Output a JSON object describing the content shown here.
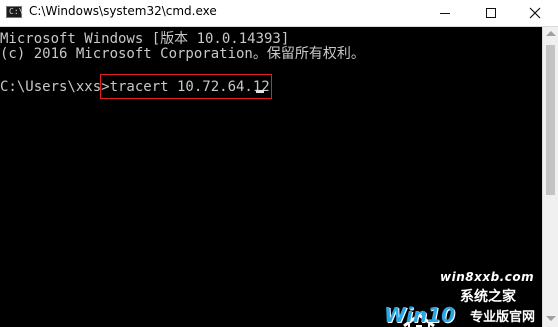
{
  "window": {
    "title": "C:\\Windows\\system32\\cmd.exe",
    "icon": "cmd-icon",
    "icon_text": "C:\\"
  },
  "console": {
    "lines": [
      "Microsoft Windows [版本 10.0.14393]",
      "(c) 2016 Microsoft Corporation。保留所有权利。",
      "C:\\Users\\xxs>tracert 10.72.64.12"
    ],
    "prompt": "C:\\Users\\xxs>",
    "command": "tracert 10.72.64.12",
    "highlight_color": "#e02020"
  },
  "watermark": {
    "top": "win8xxb.com",
    "mid": "系统之家",
    "brand": "Win10",
    "bottom": "专业版官网"
  }
}
